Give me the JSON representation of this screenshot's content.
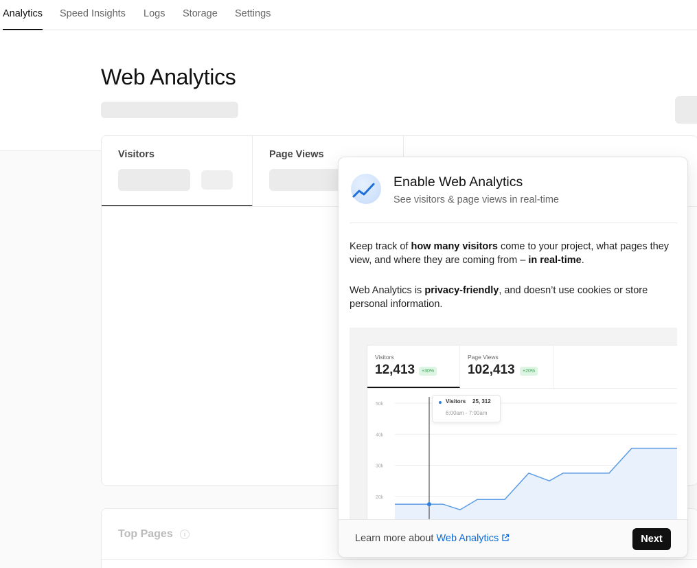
{
  "nav": {
    "tabs": [
      "Analytics",
      "Speed Insights",
      "Logs",
      "Storage",
      "Settings"
    ],
    "active": "Analytics"
  },
  "header": {
    "title": "Web Analytics"
  },
  "metrics": {
    "tabs": [
      "Visitors",
      "Page Views"
    ]
  },
  "top_pages": {
    "title": "Top Pages",
    "info": "i"
  },
  "popover": {
    "title": "Enable Web Analytics",
    "subtitle": "See visitors & page views in real-time",
    "para1": {
      "t1": "Keep track of ",
      "b1": "how many visitors",
      "t2": " come to your project, what pages they view, and where they are coming from – ",
      "b2": "in real-time",
      "t3": "."
    },
    "para2": {
      "t1": "Web Analytics is ",
      "b1": "privacy-friendly",
      "t2": ", and doesn’t use cookies or store personal information."
    },
    "footer": {
      "learn_prefix": "Learn more about ",
      "learn_link": "Web Analytics",
      "next": "Next"
    }
  },
  "preview": {
    "tabs": [
      {
        "label": "Visitors",
        "value": "12,413",
        "badge": "+30%"
      },
      {
        "label": "Page Views",
        "value": "102,413",
        "badge": "+20%"
      }
    ],
    "tooltip": {
      "series": "Visitors",
      "value": "25, 312",
      "time": "6:00am - 7:00am"
    },
    "colors": {
      "line": "#5a9be6",
      "fill": "#e9f1fc",
      "dot": "#2f7fd9"
    }
  },
  "chart_data": {
    "type": "area",
    "x": [
      0,
      1,
      2,
      3,
      4,
      5,
      6,
      7,
      8,
      9,
      10,
      11,
      12,
      13,
      14,
      15
    ],
    "series": [
      {
        "name": "Visitors",
        "values": [
          17500,
          17500,
          17500,
          15700,
          19000,
          19000,
          27500,
          25000,
          27500,
          27500,
          27500,
          35500,
          35500,
          35500
        ]
      }
    ],
    "yticks": [
      "50k",
      "40k",
      "30k",
      "20k"
    ],
    "ylim": [
      10000,
      52000
    ],
    "grid": true
  }
}
